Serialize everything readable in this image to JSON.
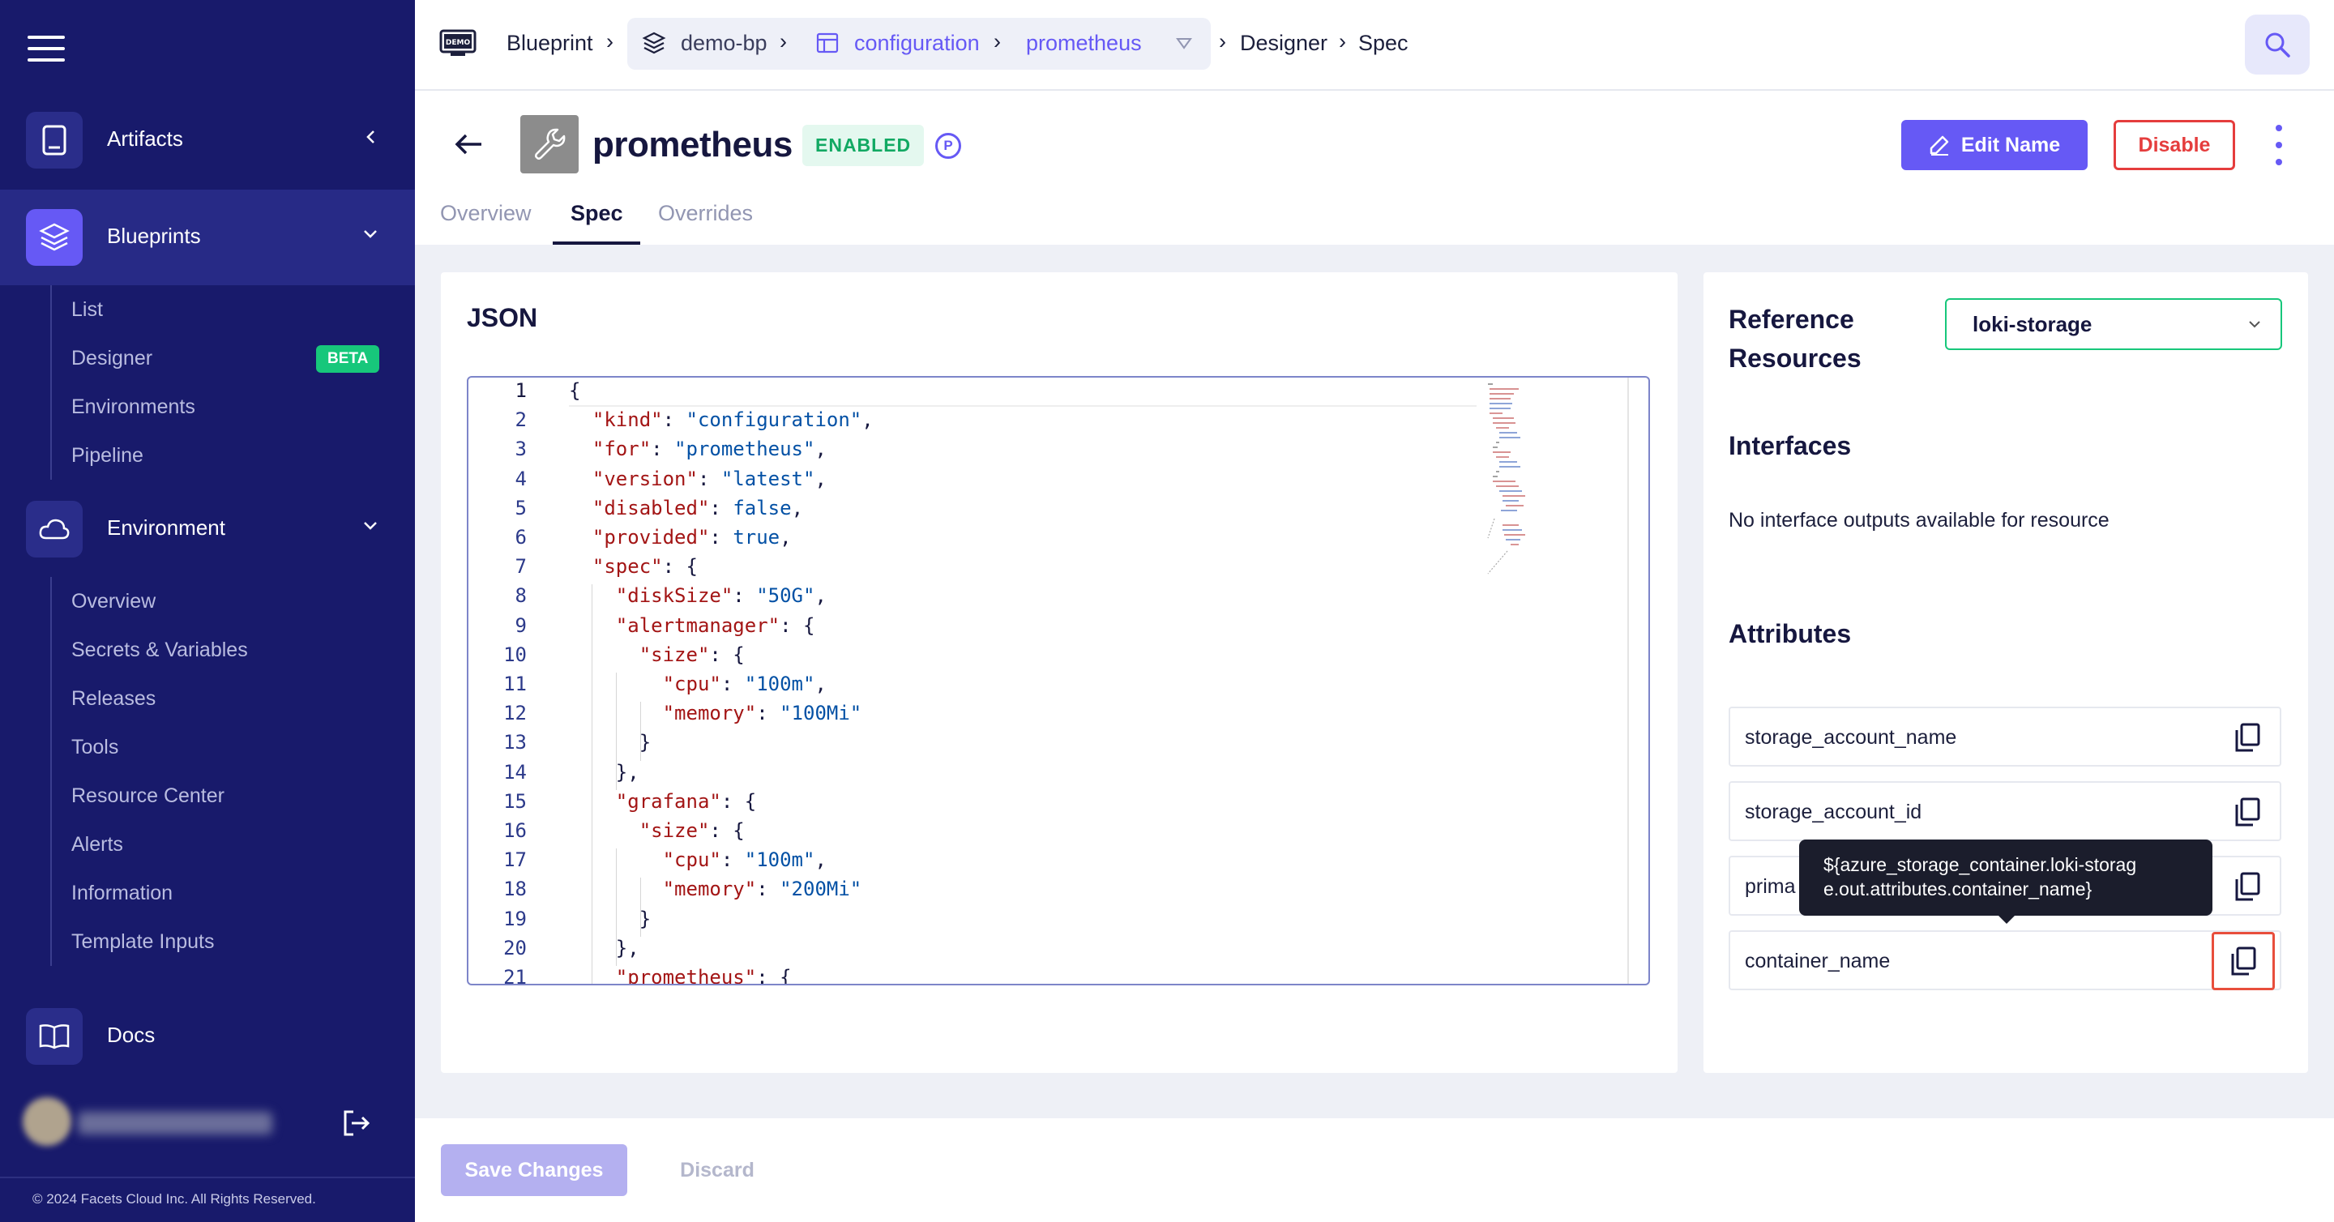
{
  "sidebar": {
    "sections": [
      {
        "label": "Artifacts",
        "icon": "artifact-icon",
        "chevron": "chevron-left-icon"
      },
      {
        "label": "Blueprints",
        "icon": "layers-icon",
        "chevron": "chevron-down-icon"
      },
      {
        "label": "Environment",
        "icon": "cloud-icon",
        "chevron": "chevron-down-icon"
      },
      {
        "label": "Docs",
        "icon": "book-icon"
      }
    ],
    "blueprint_items": [
      "List",
      "Designer",
      "Environments",
      "Pipeline"
    ],
    "designer_badge": "BETA",
    "environment_items": [
      "Overview",
      "Secrets & Variables",
      "Releases",
      "Tools",
      "Resource Center",
      "Alerts",
      "Information",
      "Template Inputs"
    ],
    "copyright": "© 2024 Facets Cloud Inc. All Rights Reserved."
  },
  "breadcrumb": {
    "items": [
      "Blueprint",
      "demo-bp",
      "configuration",
      "prometheus",
      "Designer",
      "Spec"
    ],
    "demo_logo": "DEMO"
  },
  "title": {
    "name": "prometheus",
    "status": "ENABLED",
    "badge_letter": "P",
    "edit_label": "Edit Name",
    "disable_label": "Disable"
  },
  "tabs": [
    "Overview",
    "Spec",
    "Overrides"
  ],
  "json_card": {
    "title": "JSON",
    "line_numbers": [
      "1",
      "2",
      "3",
      "4",
      "5",
      "6",
      "7",
      "8",
      "9",
      "10",
      "11",
      "12",
      "13",
      "14",
      "15",
      "16",
      "17",
      "18",
      "19",
      "20",
      "21"
    ],
    "lines": [
      "{",
      "  \"kind\": \"configuration\",",
      "  \"for\": \"prometheus\",",
      "  \"version\": \"latest\",",
      "  \"disabled\": false,",
      "  \"provided\": true,",
      "  \"spec\": {",
      "    \"diskSize\": \"50G\",",
      "    \"alertmanager\": {",
      "      \"size\": {",
      "        \"cpu\": \"100m\",",
      "        \"memory\": \"100Mi\"",
      "      }",
      "    },",
      "    \"grafana\": {",
      "      \"size\": {",
      "        \"cpu\": \"100m\",",
      "        \"memory\": \"200Mi\"",
      "      }",
      "    },",
      "    \"prometheus\": {"
    ]
  },
  "reference": {
    "title": "Reference Resources",
    "selected": "loki-storage",
    "interfaces_heading": "Interfaces",
    "no_interfaces": "No interface outputs available for resource",
    "attributes_heading": "Attributes",
    "attributes": [
      "storage_account_name",
      "storage_account_id",
      "prima",
      "container_name"
    ],
    "tooltip_line1": "${azure_storage_container.loki-storag",
    "tooltip_line2": "e.out.attributes.container_name}"
  },
  "footer": {
    "save_label": "Save Changes",
    "discard_label": "Discard"
  },
  "colors": {
    "sidebar": "#181a6b",
    "accent": "#6659f5",
    "success": "#17c77b",
    "danger": "#e53d3d"
  }
}
